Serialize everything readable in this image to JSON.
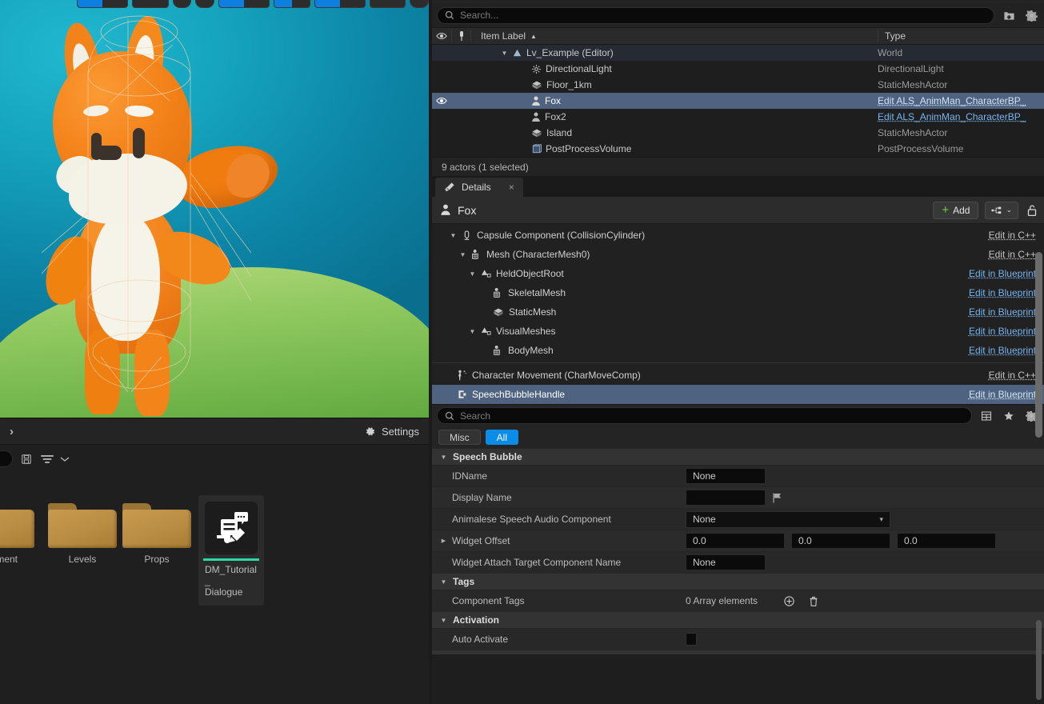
{
  "viewport": {
    "character_name": "Fox",
    "sky_color": "#12a0bb",
    "ground_color": "#8fc85f",
    "fox_color": "#f2821a"
  },
  "left_panel": {
    "expand_label": "›",
    "settings_label": "Settings",
    "settings_icon": "gear-icon",
    "save_icon": "save-icon",
    "filter_icon": "filter-icon",
    "chevron_icon": "chevron-down-icon"
  },
  "content_browser": {
    "assets": [
      {
        "name": "ronment",
        "type": "folder"
      },
      {
        "name": "Levels",
        "type": "folder"
      },
      {
        "name": "Props",
        "type": "folder"
      },
      {
        "name": "DM_Tutorial_\nDialogue",
        "type": "asset",
        "accent": "#2fd6a7",
        "icon": "dialogue-edit-icon"
      }
    ]
  },
  "outliner": {
    "search": {
      "placeholder": "Search...",
      "value": "",
      "icon": "search-icon"
    },
    "new_folder_icon": "new-folder-icon",
    "settings_icon": "gear-icon",
    "columns": {
      "eye_icon": "eye-icon",
      "pin_icon": "pin-icon",
      "item_label": "Item Label",
      "sort_arrow": "▲",
      "type": "Type"
    },
    "rows": [
      {
        "label": "Lv_Example (Editor)",
        "type": "World",
        "icon": "world-icon",
        "indent": 62,
        "expander": "▼",
        "state": "world",
        "eye": false,
        "link": false
      },
      {
        "label": "DirectionalLight",
        "type": "DirectionalLight",
        "icon": "light-icon",
        "indent": 78,
        "expander": "",
        "state": "",
        "eye": false,
        "link": false
      },
      {
        "label": "Floor_1km",
        "type": "StaticMeshActor",
        "icon": "mesh-icon",
        "indent": 78,
        "expander": "",
        "state": "",
        "eye": false,
        "link": false
      },
      {
        "label": "Fox",
        "type": "Edit ALS_AnimMan_CharacterBP_",
        "icon": "character-icon",
        "indent": 78,
        "expander": "",
        "state": "sel",
        "eye": true,
        "link": true
      },
      {
        "label": "Fox2",
        "type": "Edit ALS_AnimMan_CharacterBP_",
        "icon": "character-icon",
        "indent": 78,
        "expander": "",
        "state": "",
        "eye": false,
        "link": true
      },
      {
        "label": "Island",
        "type": "StaticMeshActor",
        "icon": "mesh-icon",
        "indent": 78,
        "expander": "",
        "state": "",
        "eye": false,
        "link": false
      },
      {
        "label": "PostProcessVolume",
        "type": "PostProcessVolume",
        "icon": "volume-icon",
        "indent": 78,
        "expander": "",
        "state": "",
        "eye": false,
        "link": false
      }
    ],
    "status": "9 actors (1 selected)"
  },
  "details": {
    "tab": {
      "label": "Details",
      "icon": "details-icon",
      "close": "×"
    },
    "actor": {
      "name": "Fox",
      "icon": "character-icon"
    },
    "toolbar": {
      "add_label": "Add",
      "add_icon": "plus-icon",
      "graph_icon": "component-graph-icon",
      "graph_chevron": "⌄",
      "lock_icon": "unlock-icon"
    },
    "components": [
      {
        "name": "Capsule Component (CollisionCylinder)",
        "edit": "Edit in C++",
        "edit_kind": "cpp",
        "indent": 22,
        "expander": "▼",
        "icon": "capsule-icon",
        "state": ""
      },
      {
        "name": "Mesh (CharacterMesh0)",
        "edit": "Edit in C++",
        "edit_kind": "cpp",
        "indent": 34,
        "expander": "▼",
        "icon": "skeletal-mesh-icon",
        "state": ""
      },
      {
        "name": "HeldObjectRoot",
        "edit": "Edit in Blueprint",
        "edit_kind": "bp",
        "indent": 46,
        "expander": "▼",
        "icon": "scene-component-icon",
        "state": ""
      },
      {
        "name": "SkeletalMesh",
        "edit": "Edit in Blueprint",
        "edit_kind": "bp",
        "indent": 61,
        "expander": "",
        "icon": "skeletal-mesh-icon",
        "state": ""
      },
      {
        "name": "StaticMesh",
        "edit": "Edit in Blueprint",
        "edit_kind": "bp",
        "indent": 61,
        "expander": "",
        "icon": "static-mesh-icon",
        "state": ""
      },
      {
        "name": "VisualMeshes",
        "edit": "Edit in Blueprint",
        "edit_kind": "bp",
        "indent": 46,
        "expander": "▼",
        "icon": "scene-component-icon",
        "state": ""
      },
      {
        "name": "BodyMesh",
        "edit": "Edit in Blueprint",
        "edit_kind": "bp",
        "indent": 61,
        "expander": "",
        "icon": "skeletal-mesh-icon",
        "state": ""
      }
    ],
    "components_after_sep": [
      {
        "name": "Character Movement (CharMoveComp)",
        "edit": "Edit in C++",
        "edit_kind": "cpp",
        "indent": 30,
        "expander": "",
        "icon": "movement-icon",
        "state": ""
      },
      {
        "name": "SpeechBubbleHandle",
        "edit": "Edit in Blueprint",
        "edit_kind": "bp",
        "indent": 30,
        "expander": "",
        "icon": "speech-bubble-handle-icon",
        "state": "sel"
      }
    ],
    "props_search": {
      "placeholder": "Search",
      "value": "",
      "icon": "search-icon"
    },
    "props_icons": {
      "grid": "table-view-icon",
      "favorite": "star-icon",
      "settings": "gear-icon"
    },
    "filters": [
      {
        "label": "Misc",
        "active": false
      },
      {
        "label": "All",
        "active": true
      }
    ],
    "sections": [
      {
        "title": "Speech Bubble",
        "expander": "▼",
        "rows": [
          {
            "label": "IDName",
            "kind": "text",
            "value": "None",
            "expander": ""
          },
          {
            "label": "Display Name",
            "kind": "text_flag",
            "value": "",
            "flag_icon": "localization-flag-icon",
            "expander": ""
          },
          {
            "label": "Animalese Speech Audio Component",
            "kind": "combo",
            "value": "None",
            "expander": ""
          },
          {
            "label": "Widget Offset",
            "kind": "vector3",
            "values": [
              "0.0",
              "0.0",
              "0.0"
            ],
            "expander": "▶"
          },
          {
            "label": "Widget Attach Target Component Name",
            "kind": "text",
            "value": "None",
            "expander": ""
          }
        ]
      },
      {
        "title": "Tags",
        "expander": "▼",
        "rows": [
          {
            "label": "Component Tags",
            "kind": "array",
            "value": "0 Array elements",
            "add_icon": "add-element-icon",
            "delete_icon": "trash-icon",
            "expander": ""
          }
        ]
      },
      {
        "title": "Activation",
        "expander": "▼",
        "rows": [
          {
            "label": "Auto Activate",
            "kind": "checkbox",
            "value": "",
            "expander": ""
          }
        ]
      }
    ]
  }
}
